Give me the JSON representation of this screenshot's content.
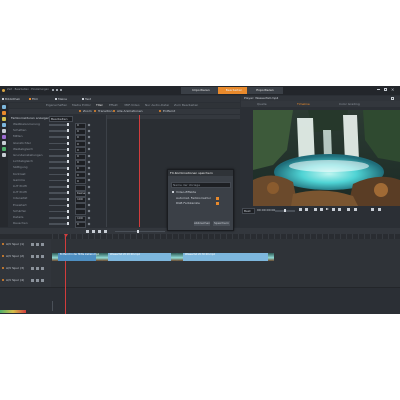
{
  "window": {
    "title": "Zeit · Bearbeiten · Einstellungen",
    "tabs": [
      "Importieren",
      "Bearbeiten",
      "Exportieren"
    ],
    "active_tab": 1
  },
  "library": {
    "tabs": [
      "Bibliothek",
      "Film",
      "Meine",
      "Test"
    ],
    "active_tab": 1
  },
  "editor_tabs": [
    "Eigenschaften",
    "Media Editor",
    "Titel",
    "Effekt",
    "3MF-Video",
    "Nur Audio-Datei",
    "Zum Bearbeiten"
  ],
  "editor_tabs_active": 2,
  "subtabs": [
    "Zoom",
    "Transition",
    "Alle Animationen",
    "Entfernt"
  ],
  "properties": {
    "top_label": "Farbkorrekturen anzeigen",
    "top_value": "Bearbeiten",
    "rows": [
      {
        "label": "Weißbalancierung",
        "value": "0"
      },
      {
        "label": "Schatten",
        "value": "0"
      },
      {
        "label": "Mitten",
        "value": "0"
      },
      {
        "label": "Glanzlichter",
        "value": "0"
      },
      {
        "label": "Weißabgleich",
        "value": "0"
      },
      {
        "label": "Grundeinstellungen",
        "value": "0"
      },
      {
        "label": "Lichtabgleich",
        "value": "0"
      },
      {
        "label": "Sättigung",
        "value": "0"
      },
      {
        "label": "Kontrast",
        "value": "0"
      },
      {
        "label": "Gamma",
        "value": "0"
      },
      {
        "label": "LUT Profil",
        "value": ""
      },
      {
        "label": "LUT Profil",
        "value": "Keine"
      },
      {
        "label": "Intensität",
        "value": "100"
      },
      {
        "label": "Erweitert",
        "value": ""
      },
      {
        "label": "Schärfen",
        "value": ""
      },
      {
        "label": "Details",
        "value": "100"
      },
      {
        "label": "Rauschen",
        "value": "0"
      }
    ]
  },
  "player": {
    "title": "Player: Wasserfall.mp4",
    "tabs": [
      "Quelle",
      "Timeline",
      "Color Grading"
    ],
    "active_tab": 1,
    "timecode": "00:00:00:00",
    "zoom": "Best"
  },
  "dialog": {
    "title": "FX-Kombinationen speichern",
    "name_placeholder": "Name der Vorlage",
    "section": "Video-Effekte",
    "items": [
      {
        "label": "Automat. Farbkorrektur",
        "checked": true
      },
      {
        "label": "RGB Farbkanäle",
        "checked": true
      }
    ],
    "cancel": "Abbrechen",
    "save": "Speichern"
  },
  "timeline": {
    "tracks": [
      "A/V Spur (1)",
      "A/V Spur (2)",
      "A/V Spur (3)",
      "A/V Spur (4)"
    ],
    "clips": [
      {
        "label": "Entfernt in der Mitte ziehen.mp4"
      },
      {
        "label": "Wasserfall 20:20:00.mp4"
      },
      {
        "label": "Wasserfall 20:30:00.mp4"
      }
    ]
  },
  "colors": {
    "bg": "#2b2f35",
    "panel": "#33373d",
    "accent_orange": "#e98a2c",
    "playhead": "#d23c3c",
    "clip_blue": "#7db7dd",
    "clip_blue_dark": "#4e8fc2"
  }
}
